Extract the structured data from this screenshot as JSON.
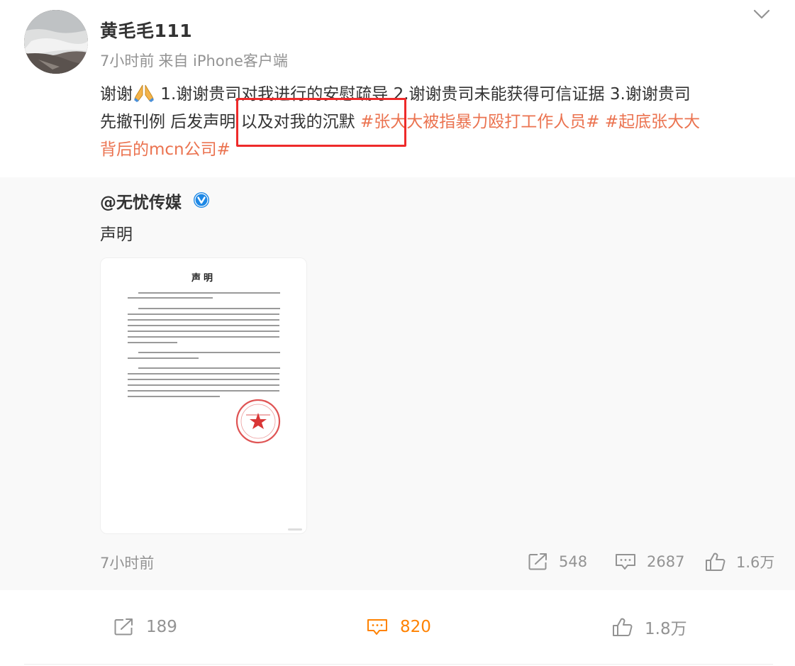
{
  "post": {
    "username": "黄毛毛111",
    "time": "7小时前",
    "source": "来自 iPhone客户端",
    "text": {
      "line1": "谢谢",
      "line1_rest": " 1.谢谢贵司对我进行的安慰疏导 2.谢谢贵司未能获得可信证据 3.谢谢贵司",
      "line2_text": "先撤刊例 后发声明 以及对我的沉默 ",
      "line2_topic": "#张大大被指暴力殴打工作人员#",
      "line2_sep": " ",
      "line2_topic2_start": "#起底张大大",
      "line3_topic2_end": "背后的mcn公司#"
    },
    "emoji": "folded-hands"
  },
  "repost": {
    "author": "@无忧传媒",
    "text": "声明",
    "document_title": "声明",
    "time": "7小时前",
    "shares": "548",
    "comments": "2687",
    "likes": "1.6万"
  },
  "footer": {
    "shares": "189",
    "comments": "820",
    "likes": "1.8万"
  },
  "colors": {
    "topic": "#eb7350",
    "active_comment": "#ff8200",
    "highlight_box": "#ee2a2a",
    "muted": "#939393",
    "repost_bg": "#f9f9f9"
  },
  "icons": {
    "menu": "chevron-down-icon",
    "verified": "verified-badge-icon",
    "share": "share-icon",
    "comment": "comment-icon",
    "like": "thumbs-up-icon",
    "stamp": "red-seal-stamp"
  }
}
